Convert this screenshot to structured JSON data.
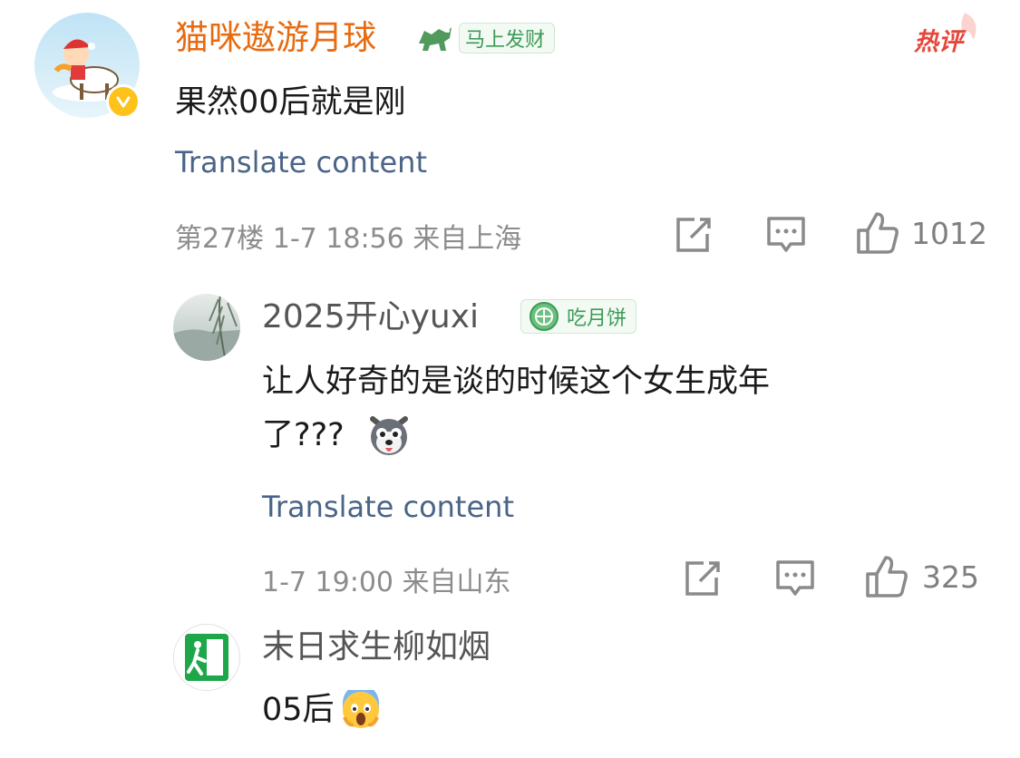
{
  "comments": [
    {
      "username": "猫咪遨游月球",
      "badge": "马上发财",
      "badge_icon": "horse-icon",
      "hot_tag": "热评",
      "content": "果然00后就是刚",
      "translate": "Translate content",
      "floor": "第27楼",
      "time": "1-7 18:56",
      "location": "来自上海",
      "likes": "1012",
      "verified": true,
      "name_color": "#e86b10"
    },
    {
      "username": "2025开心yuxi",
      "badge": "吃月饼",
      "badge_icon": "mooncake-icon",
      "content_line1": "让人好奇的是谈的时候这个女生成年",
      "content_line2": "了???",
      "content_emoji": "dog-emoji-icon",
      "translate": "Translate content",
      "time": "1-7 19:00",
      "location": "来自山东",
      "likes": "325"
    },
    {
      "username": "末日求生柳如烟",
      "content": "05后",
      "content_emoji": "scream-emoji-icon"
    }
  ],
  "colors": {
    "link": "#4a6487",
    "meta": "#8c8c8c",
    "hot": "#e5473a",
    "badge_green": "#3d9b58"
  }
}
